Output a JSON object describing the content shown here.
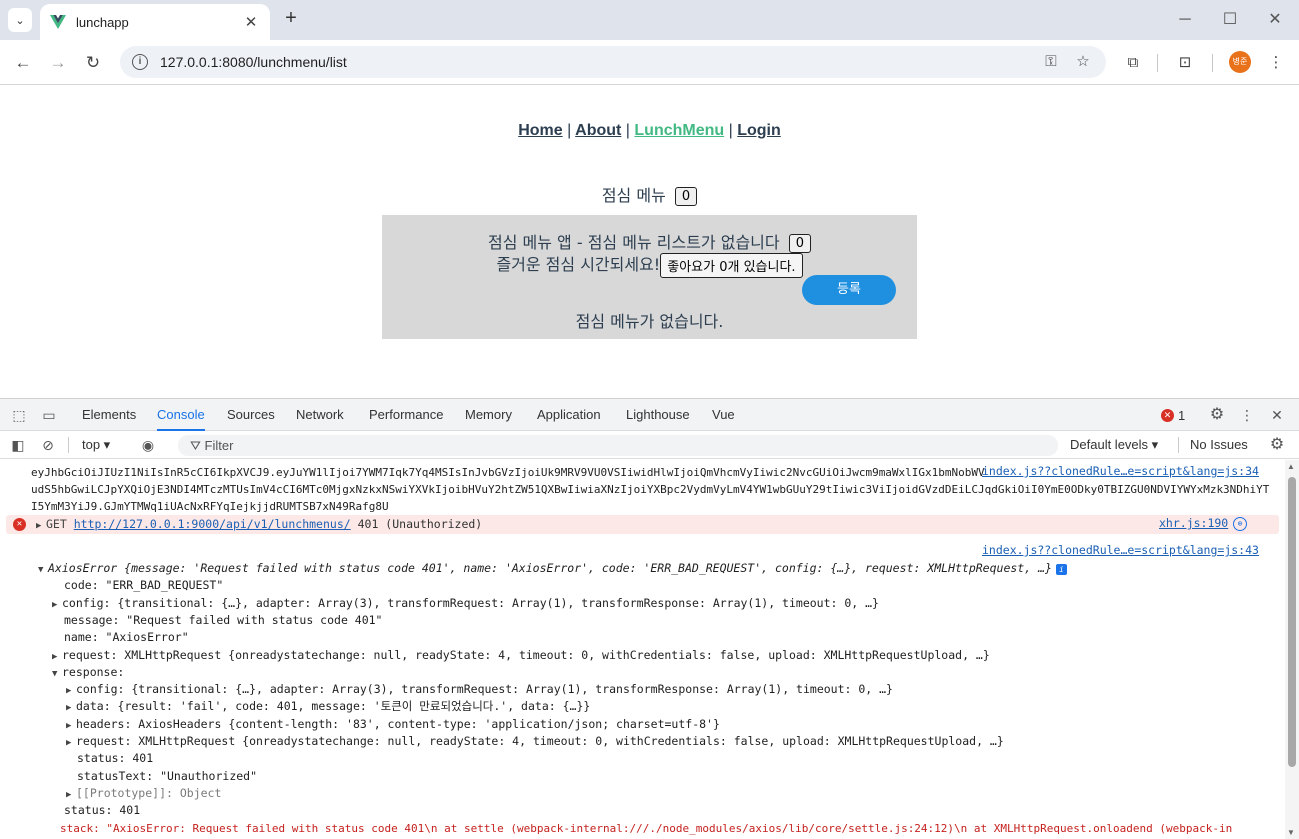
{
  "browser": {
    "tab_title": "lunchapp",
    "url": "127.0.0.1:8080/lunchmenu/list",
    "avatar_text": "병준"
  },
  "page": {
    "nav": {
      "home": "Home",
      "about": "About",
      "lunchmenu": "LunchMenu",
      "login": "Login",
      "sep": "|"
    },
    "menu_title": "점심 메뉴",
    "menu_count": "0",
    "card": {
      "line1": "점심 메뉴 앱 - 점심 메뉴 리스트가 없습니다",
      "line1_count": "0",
      "line2": "즐거운 점심 시간되세요!",
      "like_button": "좋아요가 0개 있습니다.",
      "register_button": "등록",
      "empty_message": "점심 메뉴가 없습니다."
    }
  },
  "devtools": {
    "tabs": [
      "Elements",
      "Console",
      "Sources",
      "Network",
      "Performance",
      "Memory",
      "Application",
      "Lighthouse",
      "Vue"
    ],
    "active_tab": "Console",
    "error_count": "1",
    "context": "top ▾",
    "filter_placeholder": "Filter",
    "levels": "Default levels ▾",
    "issues": "No Issues",
    "console": {
      "token_line1": "eyJhbGciOiJIUzI1NiIsInR5cCI6IkpXVCJ9.eyJuYW1lIjoi7YWM7Iqk7Yq4MSIsInJvbGVzIjoiUk9MRV9VU0VSIiwidHlwIjoiQmVhcmVyIiwic2NvcGUiOiJwcm9maWxlIGx1bmNobWV",
      "token_line2": "udS5hbGwiLCJpYXQiOjE3NDI4MTczMTUsImV4cCI6MTc0MjgxNzkxNSwiYXVkIjoibHVuY2htZW51QXBwIiwiaXNzIjoiYXBpc2VydmVyLmV4YW1wbGUuY29tIiwic3ViIjoidGVzdDEiLCJqdGkiOiI0YmE0ODky0TBIZGU0NDVIYWYxMzk3NDhiYT",
      "token_line3": "I5YmM3YiJ9.GJmYTMWq1iUAcNxRFYqIejkjjdRUMTSB7xN49Rafg8U",
      "src1": "index.js??clonedRule…e=script&lang=js:34",
      "get_method": "GET",
      "get_url": "http://127.0.0.1:9000/api/v1/lunchmenus/",
      "get_status": "401 (Unauthorized)",
      "src_xhr": "xhr.js:190",
      "src2": "index.js??clonedRule…e=script&lang=js:43",
      "axios_header": "AxiosError {message: 'Request failed with status code 401', name: 'AxiosError', code: 'ERR_BAD_REQUEST', config: {…}, request: XMLHttpRequest, …}",
      "code_line": "code: \"ERR_BAD_REQUEST\"",
      "config_line": "config: {transitional: {…}, adapter: Array(3), transformRequest: Array(1), transformResponse: Array(1), timeout: 0, …}",
      "message_line": "message: \"Request failed with status code 401\"",
      "name_line": "name: \"AxiosError\"",
      "request_line": "request: XMLHttpRequest {onreadystatechange: null, readyState: 4, timeout: 0, withCredentials: false, upload: XMLHttpRequestUpload, …}",
      "response_line": "response:",
      "r_config_line": "config: {transitional: {…}, adapter: Array(3), transformRequest: Array(1), transformResponse: Array(1), timeout: 0, …}",
      "r_data_line": "data: {result: 'fail', code: 401, message: '토큰이 만료되었습니다.', data: {…}}",
      "r_headers_line": "headers: AxiosHeaders {content-length: '83', content-type: 'application/json; charset=utf-8'}",
      "r_request_line": "request: XMLHttpRequest {onreadystatechange: null, readyState: 4, timeout: 0, withCredentials: false, upload: XMLHttpRequestUpload, …}",
      "r_status_line": "status: 401",
      "r_statustext_line": "statusText: \"Unauthorized\"",
      "r_proto_line": "[[Prototype]]: Object",
      "status_line": "status: 401",
      "stack_line": "stack: \"AxiosError: Request failed with status code 401\\n    at settle (webpack-internal:///./node_modules/axios/lib/core/settle.js:24:12)\\n    at XMLHttpRequest.onloadend (webpack-in"
    }
  }
}
